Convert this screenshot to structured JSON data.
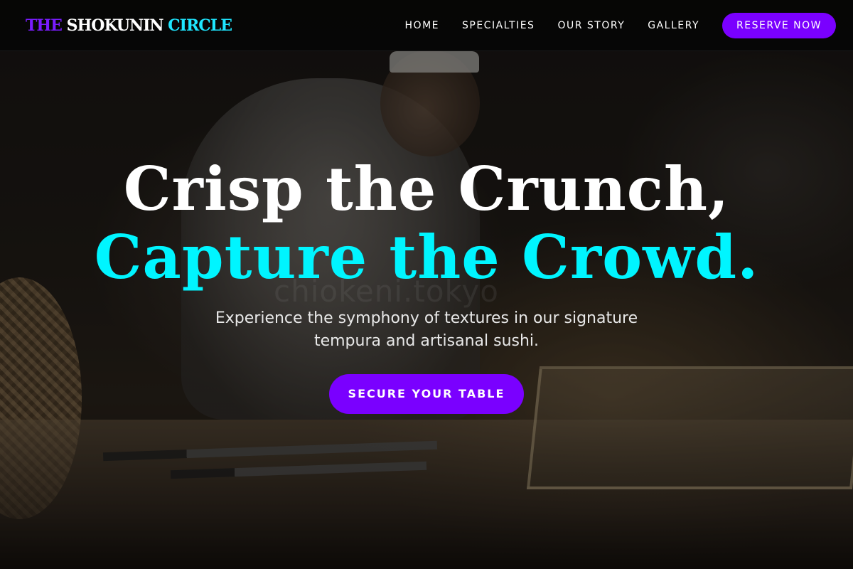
{
  "navbar": {
    "logo": {
      "part1": "THE",
      "part2": "SHOKUNIN",
      "part3": "CIRCLE"
    },
    "links": [
      {
        "label": "HOME"
      },
      {
        "label": "SPECIALTIES"
      },
      {
        "label": "OUR STORY"
      },
      {
        "label": "GALLERY"
      }
    ],
    "reserve_label": "RESERVE NOW"
  },
  "hero": {
    "headline_line1": "Crisp the Crunch,",
    "headline_line2": "Capture the Crowd.",
    "subtitle": "Experience the symphony of textures in our signature tempura and artisanal sushi.",
    "cta_label": "SECURE YOUR TABLE",
    "watermark": "chiokeni.tokyo"
  },
  "colors": {
    "accent_purple": "#7a00ff",
    "accent_cyan": "#00f5ff",
    "nav_background": "#050505"
  }
}
